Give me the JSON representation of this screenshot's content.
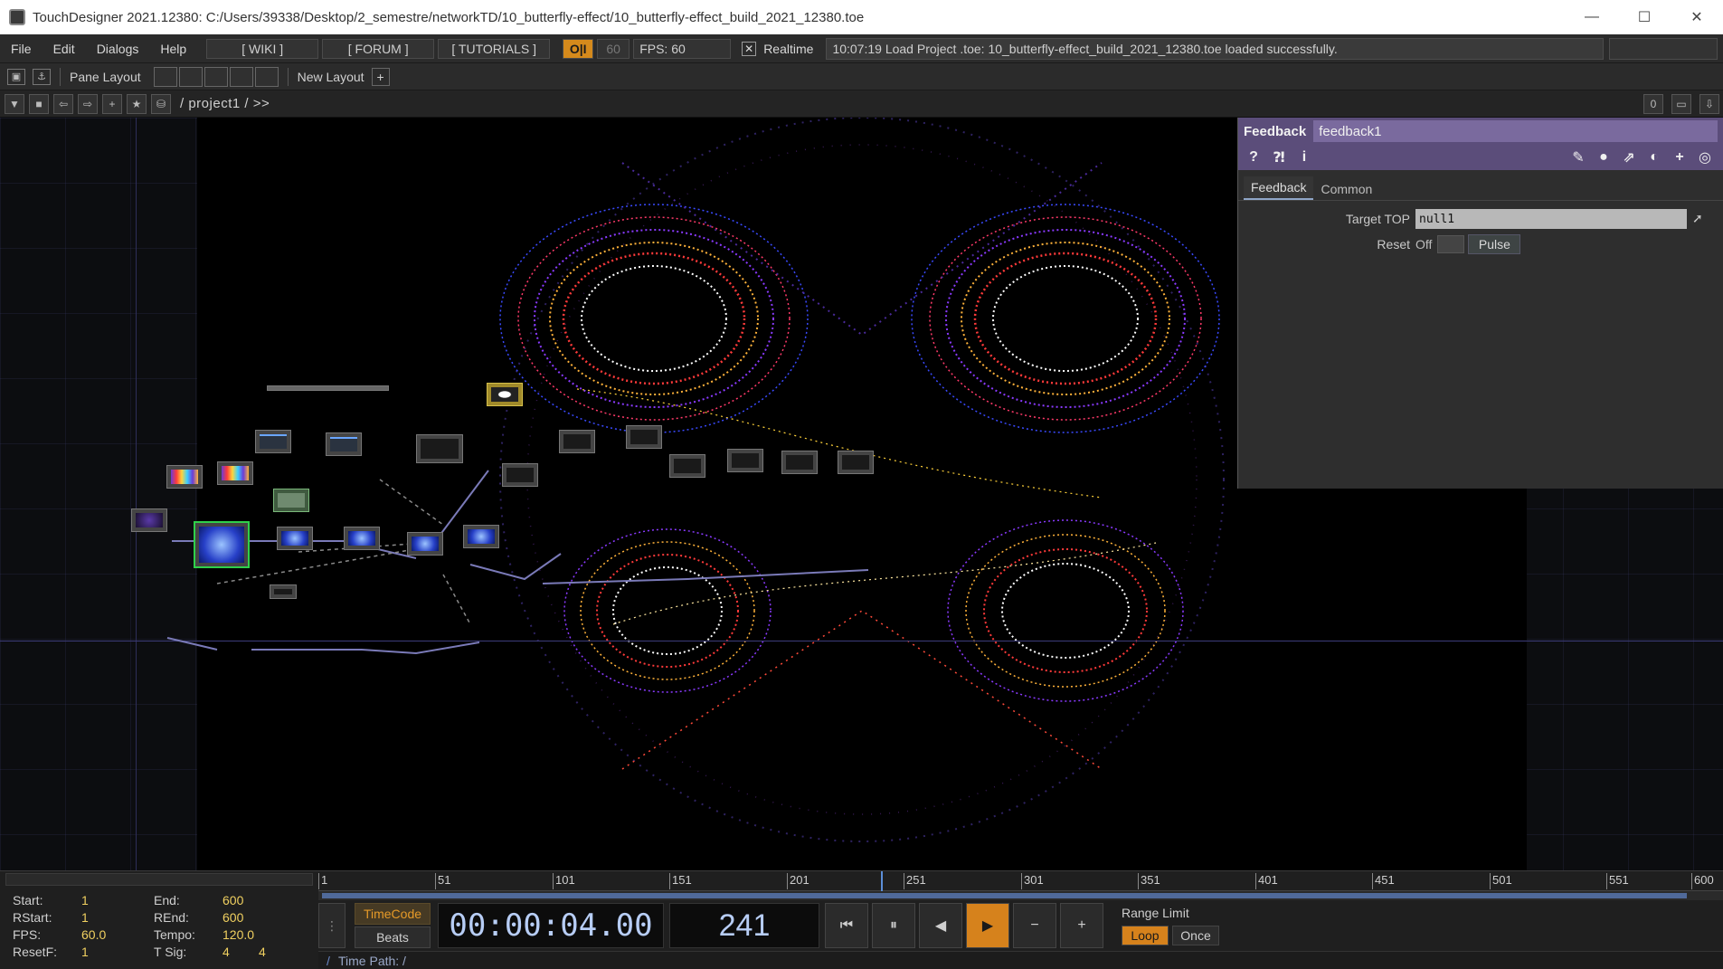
{
  "window": {
    "title": "TouchDesigner 2021.12380: C:/Users/39338/Desktop/2_semestre/networkTD/10_butterfly-effect/10_butterfly-effect_build_2021_12380.toe",
    "minimize": "—",
    "maximize": "☐",
    "close": "✕"
  },
  "menu": {
    "items": [
      "File",
      "Edit",
      "Dialogs",
      "Help"
    ],
    "wiki": "[ WIKI ]",
    "forum": "[ FORUM ]",
    "tutorials": "[ TUTORIALS ]",
    "oi": "O|I",
    "fps_setting": "60",
    "fps": "FPS:  60",
    "realtime_label": "Realtime",
    "status_message": "10:07:19 Load Project .toe: 10_butterfly-effect_build_2021_12380.toe loaded successfully."
  },
  "panebar": {
    "pane_layout_label": "Pane Layout",
    "new_layout_label": "New Layout",
    "plus": "+"
  },
  "pathbar": {
    "path": "/ project1 / >>",
    "counter": "0"
  },
  "params": {
    "op_type": "Feedback",
    "op_name": "feedback1",
    "tabs": [
      "Feedback",
      "Common"
    ],
    "target_top_label": "Target TOP",
    "target_top_value": "null1",
    "reset_label": "Reset",
    "reset_state": "Off",
    "pulse_label": "Pulse"
  },
  "timeline": {
    "start_label": "Start:",
    "start": "1",
    "end_label": "End:",
    "end": "600",
    "rstart_label": "RStart:",
    "rstart": "1",
    "rend_label": "REnd:",
    "rend": "600",
    "fps_label": "FPS:",
    "fps": "60.0",
    "tempo_label": "Tempo:",
    "tempo": "120.0",
    "resetf_label": "ResetF:",
    "resetf": "1",
    "tsig_label": "T Sig:",
    "tsig_a": "4",
    "tsig_b": "4",
    "ticks": [
      "1",
      "51",
      "101",
      "151",
      "201",
      "251",
      "301",
      "351",
      "401",
      "451",
      "501",
      "551",
      "600"
    ],
    "timecode_btn": "TimeCode",
    "beats_btn": "Beats",
    "timecode": "00:00:04.00",
    "frame": "241",
    "range_limit_label": "Range Limit",
    "loop": "Loop",
    "once": "Once",
    "time_path": "Time Path: /"
  }
}
